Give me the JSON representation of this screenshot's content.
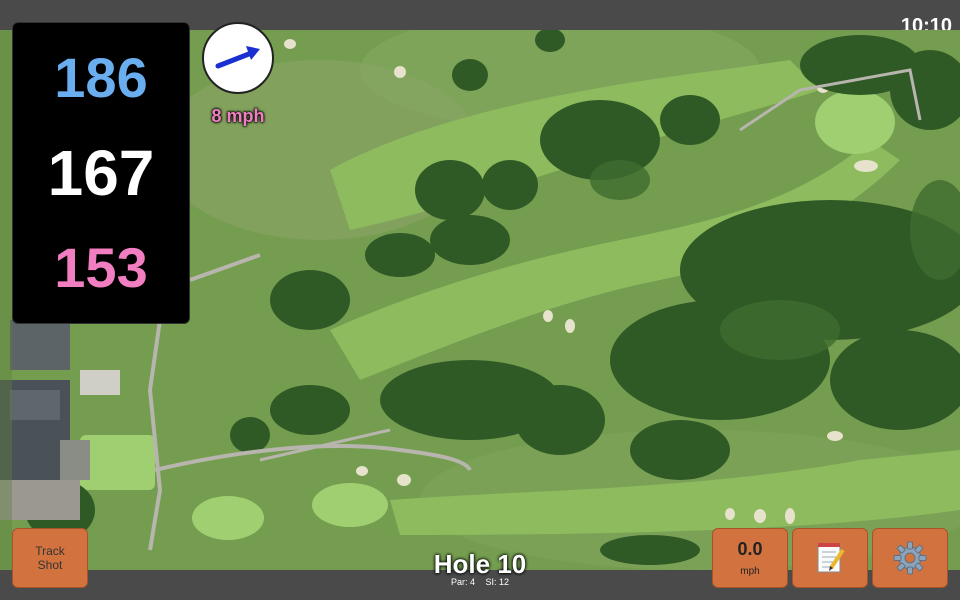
{
  "status": {
    "time": "10:10"
  },
  "yardage": {
    "back": "186",
    "middle": "167",
    "front": "153"
  },
  "wind": {
    "speed": "8 mph",
    "direction_icon": "arrow-right-up-icon"
  },
  "hole": {
    "title": "Hole 10",
    "par": "Par: 4",
    "si": "SI: 12"
  },
  "buttons": {
    "track_shot_line1": "Track",
    "track_shot_line2": "Shot",
    "speed_value": "0.0",
    "speed_unit": "mph",
    "notes_icon": "notepad-icon",
    "settings_icon": "gear-icon"
  },
  "colors": {
    "back": "#6aaef0",
    "middle": "#ffffff",
    "front": "#f07ec0",
    "wind_text": "#f07ec0",
    "button": "#d2733f"
  }
}
